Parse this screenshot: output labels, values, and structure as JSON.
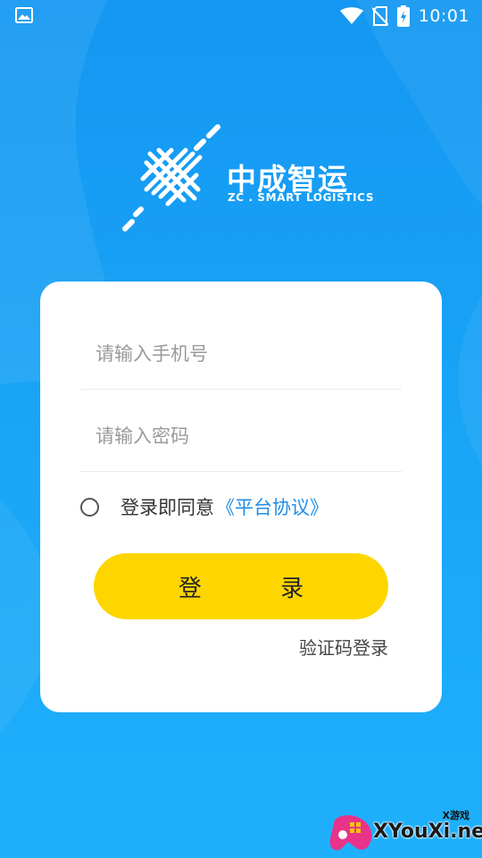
{
  "status_bar": {
    "time": "10:01",
    "icons": [
      "image-icon",
      "wifi-icon",
      "no-sim-icon",
      "battery-charging-icon"
    ]
  },
  "logo": {
    "title": "中成智运",
    "subtitle": "ZC . SMART LOGISTICS"
  },
  "form": {
    "phone_placeholder": "请输入手机号",
    "password_placeholder": "请输入密码",
    "agree_text": "登录即同意",
    "agree_link": "《平台协议》",
    "login_button": "登 录",
    "sms_login": "验证码登录"
  },
  "watermark": {
    "small": "X游戏",
    "text": "XYouXi.net"
  },
  "colors": {
    "background": "#1aa6f7",
    "button": "#fdd600",
    "link": "#1f8de8"
  }
}
